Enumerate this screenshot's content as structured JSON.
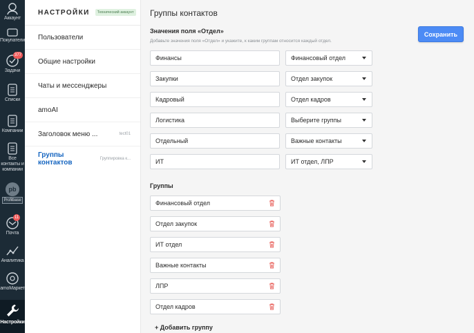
{
  "rail": {
    "items": [
      {
        "label": "Аккаунт",
        "icon": "account-icon"
      },
      {
        "label": "Покупатели",
        "icon": "buyers-icon"
      },
      {
        "label": "Задачи",
        "icon": "tasks-icon",
        "badge": "377"
      },
      {
        "label": "Списки",
        "icon": "lists-icon"
      },
      {
        "label": "Компании",
        "icon": "companies-icon"
      },
      {
        "label": "Все контакты и компании",
        "icon": "contacts-icon"
      },
      {
        "label": "Profitbase",
        "icon": "profitbase-icon",
        "circle": "pb"
      },
      {
        "label": "Почта",
        "icon": "mail-icon",
        "badge": "11"
      },
      {
        "label": "Аналитика",
        "icon": "analytics-icon"
      },
      {
        "label": "amoМаркет",
        "icon": "market-icon"
      },
      {
        "label": "Настройки",
        "icon": "settings-icon"
      }
    ]
  },
  "nav": {
    "title": "НАСТРОЙКИ",
    "tech_badge": "Технический аккаунт",
    "items": [
      {
        "label": "Пользователи",
        "sub": ""
      },
      {
        "label": "Общие настройки",
        "sub": ""
      },
      {
        "label": "Чаты и мессенджеры",
        "sub": ""
      },
      {
        "label": "amoAI",
        "sub": ""
      },
      {
        "label": "Заголовок меню ...",
        "sub": "tect01"
      },
      {
        "label": "Группы контактов",
        "sub": "Группировка к..."
      }
    ]
  },
  "main": {
    "title": "Группы контактов",
    "field_section": {
      "title": "Значения поля «Отдел»",
      "description": "Добавьте значения поля «Отдел» и укажите, к каким группам относится каждый отдел."
    },
    "save_label": "Сохранить",
    "mappings": [
      {
        "value": "Финансы",
        "group": "Финансовый отдел"
      },
      {
        "value": "Закупки",
        "group": "Отдел закупок"
      },
      {
        "value": "Кадровый",
        "group": "Отдел кадров"
      },
      {
        "value": "Логистика",
        "group": "Выберите группы"
      },
      {
        "value": "Отдельный",
        "group": "Важные контакты"
      },
      {
        "value": "ИТ",
        "group": "ИТ отдел, ЛПР"
      }
    ],
    "groups_title": "Группы",
    "groups": [
      "Финансовый отдел",
      "Отдел закупок",
      "ИТ отдел",
      "Важные контакты",
      "ЛПР",
      "Отдел кадров"
    ],
    "add_group_label": "+ Добавить группу"
  },
  "colors": {
    "accent": "#4c8bf5",
    "rail_bg": "#1c2b36",
    "badge": "#f05a5a",
    "active_link": "#1565c0",
    "trash": "#e8625c"
  }
}
